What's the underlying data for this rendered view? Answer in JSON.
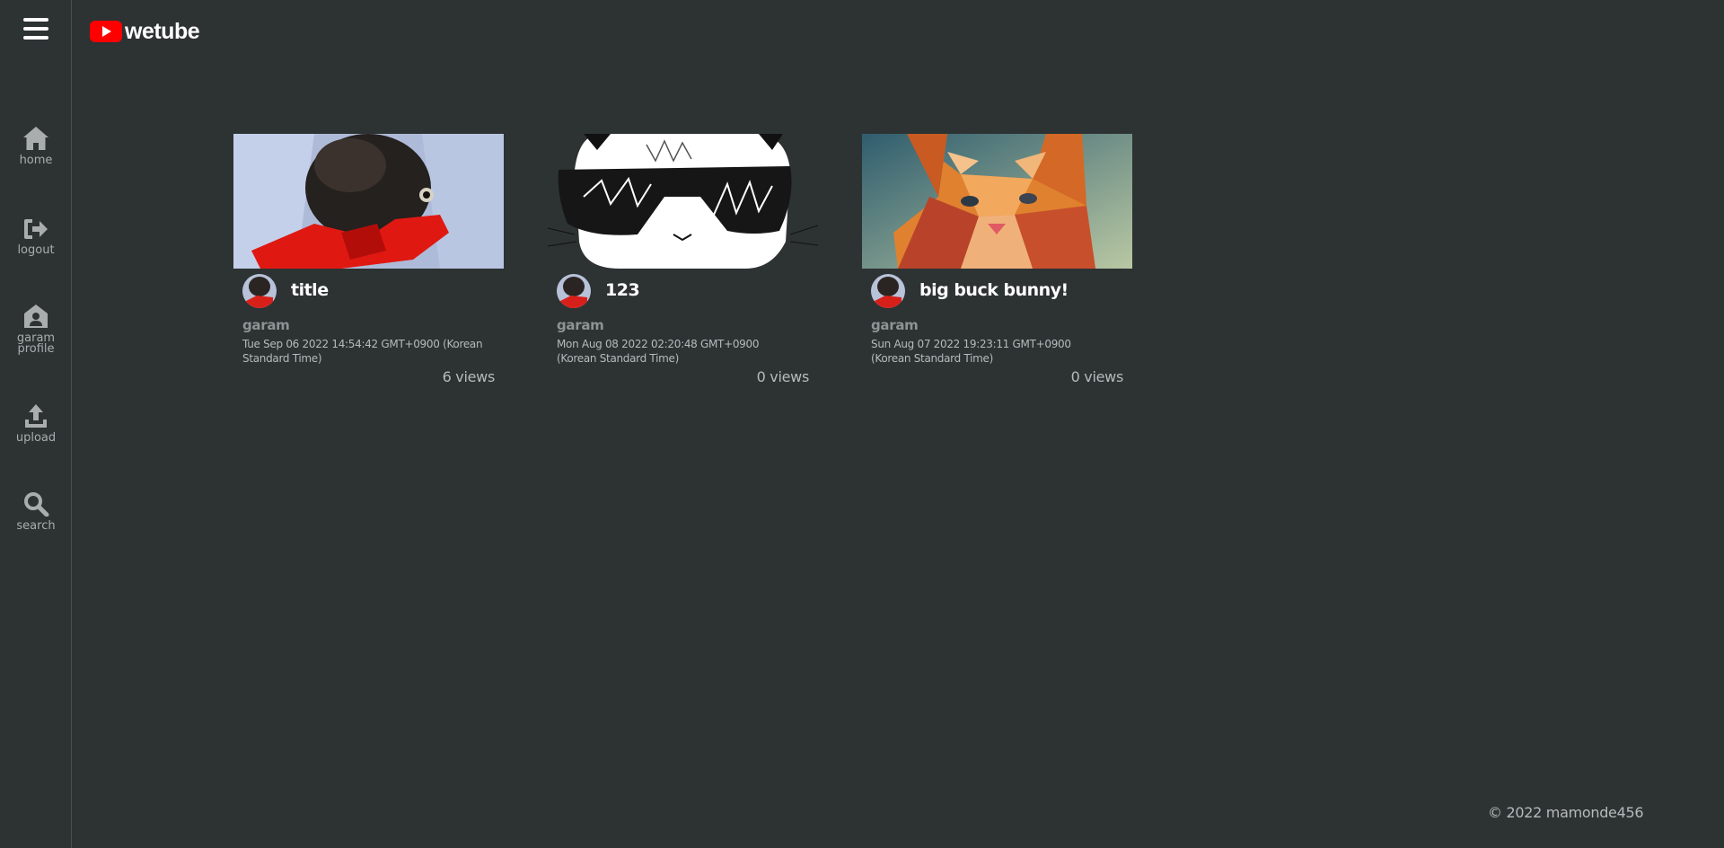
{
  "app": {
    "name": "wetube",
    "logo_icon": "youtube-play-icon",
    "brand_color": "#ff0000",
    "background": "#2d3233"
  },
  "sidebar": {
    "menu_icon": "hamburger-menu-icon",
    "items": [
      {
        "label": "home",
        "icon": "home-icon"
      },
      {
        "label": "logout",
        "icon": "logout-icon"
      },
      {
        "label": "garam profile",
        "icon": "user-house-icon"
      },
      {
        "label": "upload",
        "icon": "upload-icon"
      },
      {
        "label": "search",
        "icon": "search-icon"
      }
    ]
  },
  "videos": [
    {
      "title": "title",
      "owner": "garam",
      "created_at": "Tue Sep 06 2022 14:54:42 GMT+0900 (Korean Standard Time)",
      "views": "6 views"
    },
    {
      "title": "123",
      "owner": "garam",
      "created_at": "Mon Aug 08 2022 02:20:48 GMT+0900 (Korean Standard Time)",
      "views": "0 views"
    },
    {
      "title": "big buck bunny!",
      "owner": "garam",
      "created_at": "Sun Aug 07 2022 19:23:11 GMT+0900 (Korean Standard Time)",
      "views": "0 views"
    }
  ],
  "footer": {
    "copyright": "© 2022 mamonde456"
  }
}
